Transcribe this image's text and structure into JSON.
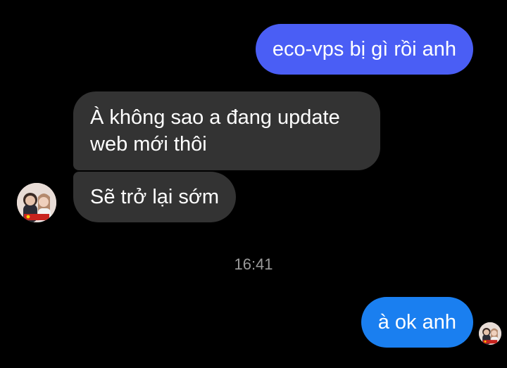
{
  "messages": [
    {
      "direction": "outgoing",
      "text": "eco-vps bị gì rồi anh"
    },
    {
      "direction": "incoming",
      "text": "À không sao a đang update web mới thôi"
    },
    {
      "direction": "incoming",
      "text": "Sẽ trở lại sớm"
    },
    {
      "direction": "outgoing",
      "text": "à ok anh"
    }
  ],
  "timestamp": "16:41",
  "colors": {
    "background": "#000000",
    "outgoing_bubble": "#4a5ef5",
    "outgoing_bubble_latest": "#1a7ff0",
    "incoming_bubble": "#333333",
    "timestamp_text": "#9a9a9a"
  },
  "icons": {
    "contact_avatar": "contact-avatar-photo",
    "self_avatar": "seen-avatar-photo"
  }
}
